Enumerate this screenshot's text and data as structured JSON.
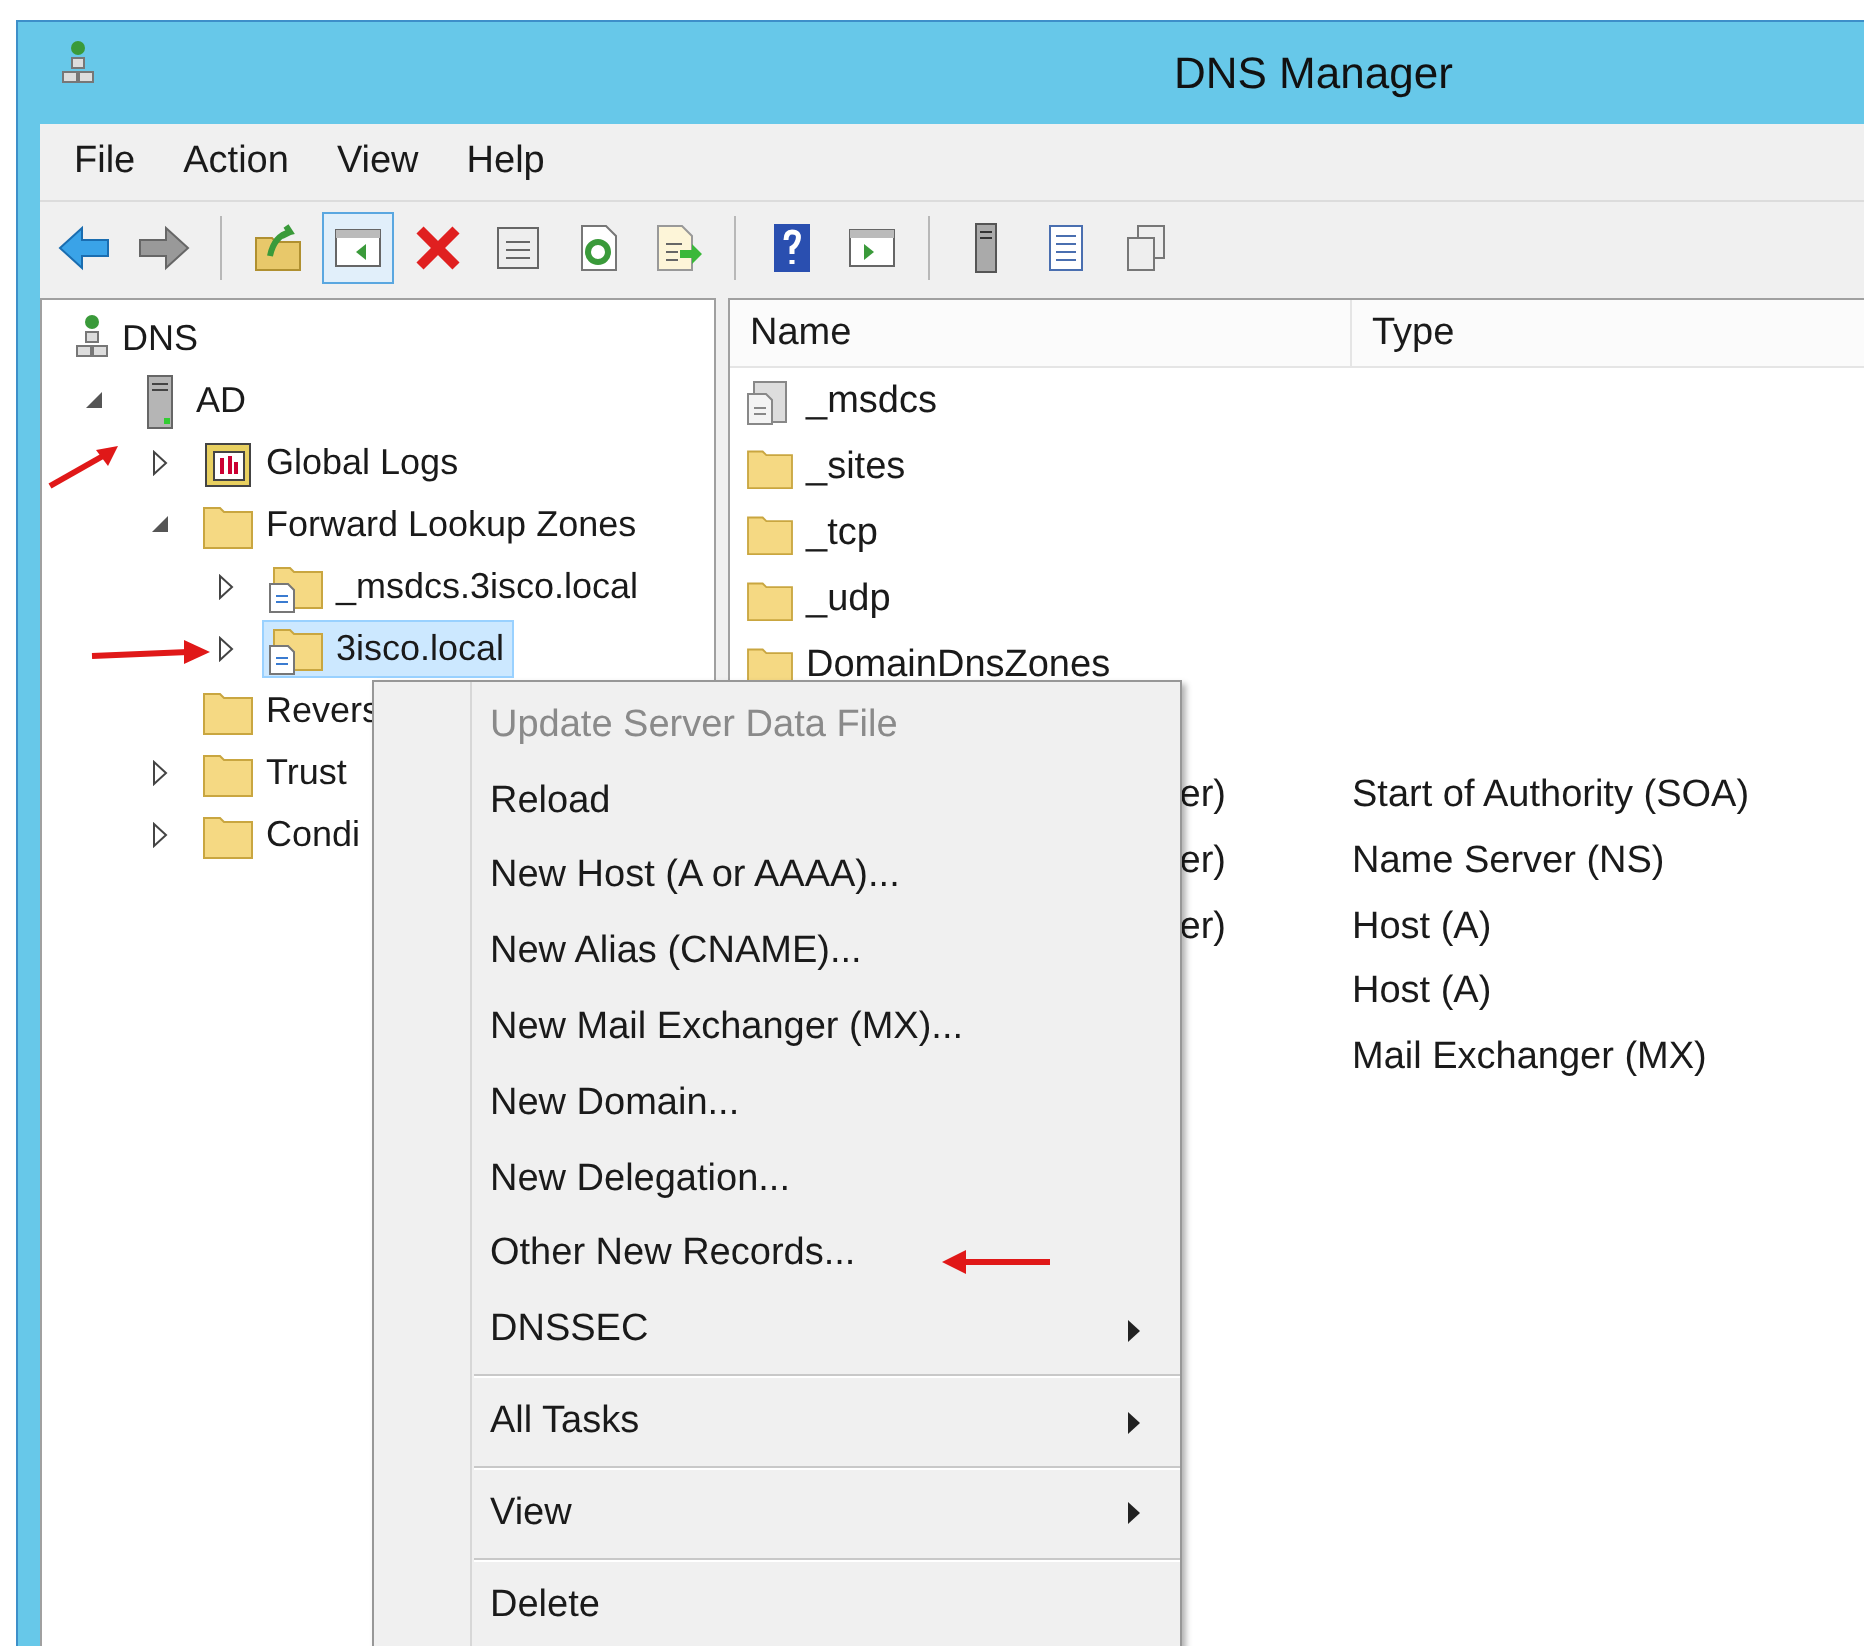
{
  "window": {
    "title": "DNS Manager"
  },
  "menu_bar": [
    "File",
    "Action",
    "View",
    "Help"
  ],
  "toolbar": [
    [
      {
        "kind": "back",
        "pressed": false
      },
      {
        "kind": "forward",
        "pressed": false
      }
    ],
    [
      {
        "kind": "up",
        "pressed": false
      },
      {
        "kind": "tree",
        "pressed": true
      },
      {
        "kind": "delete",
        "pressed": false
      },
      {
        "kind": "properties",
        "pressed": false
      },
      {
        "kind": "refresh",
        "pressed": false
      },
      {
        "kind": "export",
        "pressed": false
      }
    ],
    [
      {
        "kind": "help",
        "pressed": false
      },
      {
        "kind": "pane",
        "pressed": false
      }
    ],
    [
      {
        "kind": "server",
        "pressed": false
      },
      {
        "kind": "list",
        "pressed": false
      },
      {
        "kind": "copy",
        "pressed": false
      }
    ]
  ],
  "tree": [
    {
      "label": "DNS",
      "kind": "dns",
      "selected": false,
      "children": [
        {
          "label": "AD",
          "kind": "server",
          "expanded": true,
          "selected": false,
          "children": [
            {
              "label": "Global Logs",
              "kind": "logs",
              "expanded": false,
              "selected": false
            },
            {
              "label": "Forward Lookup Zones",
              "kind": "folder",
              "expanded": true,
              "selected": false,
              "children": [
                {
                  "label": "_msdcs.3isco.local",
                  "kind": "zone",
                  "expanded": false,
                  "selected": false
                },
                {
                  "label": "3isco.local",
                  "kind": "zone",
                  "expanded": false,
                  "selected": true
                }
              ]
            },
            {
              "label": "Revers",
              "kind": "folder",
              "selected": false
            },
            {
              "label": "Trust",
              "kind": "folder",
              "expanded": false,
              "selected": false
            },
            {
              "label": "Condi",
              "kind": "folder",
              "expanded": false,
              "selected": false
            }
          ]
        }
      ]
    }
  ],
  "list": {
    "columns": [
      "Name",
      "Type"
    ],
    "rows": [
      {
        "name": "_msdcs",
        "kind": "delegation"
      },
      {
        "name": "_sites",
        "kind": "folder"
      },
      {
        "name": "_tcp",
        "kind": "folder"
      },
      {
        "name": "_udp",
        "kind": "folder"
      },
      {
        "name": "DomainDnsZones",
        "kind": "folder"
      }
    ],
    "records": [
      {
        "name": "er)",
        "type": "Start of Authority (SOA)"
      },
      {
        "name": "er)",
        "type": "Name Server (NS)"
      },
      {
        "name": "er)",
        "type": "Host (A)"
      },
      {
        "type": "Host (A)"
      },
      {
        "type": "Mail Exchanger (MX)"
      }
    ]
  },
  "context_menu": [
    [
      {
        "label": "Update Server Data File",
        "disabled": true,
        "submenu": false
      },
      {
        "label": "Reload",
        "disabled": false,
        "submenu": false
      },
      {
        "label": "New Host (A or AAAA)...",
        "disabled": false,
        "submenu": false
      },
      {
        "label": "New Alias (CNAME)...",
        "disabled": false,
        "submenu": false
      },
      {
        "label": "New Mail Exchanger (MX)...",
        "disabled": false,
        "submenu": false
      },
      {
        "label": "New Domain...",
        "disabled": false,
        "submenu": false
      },
      {
        "label": "New Delegation...",
        "disabled": false,
        "submenu": false
      },
      {
        "label": "Other New Records...",
        "disabled": false,
        "submenu": false
      },
      {
        "label": "DNSSEC",
        "disabled": false,
        "submenu": true
      }
    ],
    [
      {
        "label": "All Tasks",
        "disabled": false,
        "submenu": true
      }
    ],
    [
      {
        "label": "View",
        "disabled": false,
        "submenu": true
      }
    ],
    [
      {
        "label": "Delete",
        "disabled": false,
        "submenu": false
      }
    ]
  ]
}
